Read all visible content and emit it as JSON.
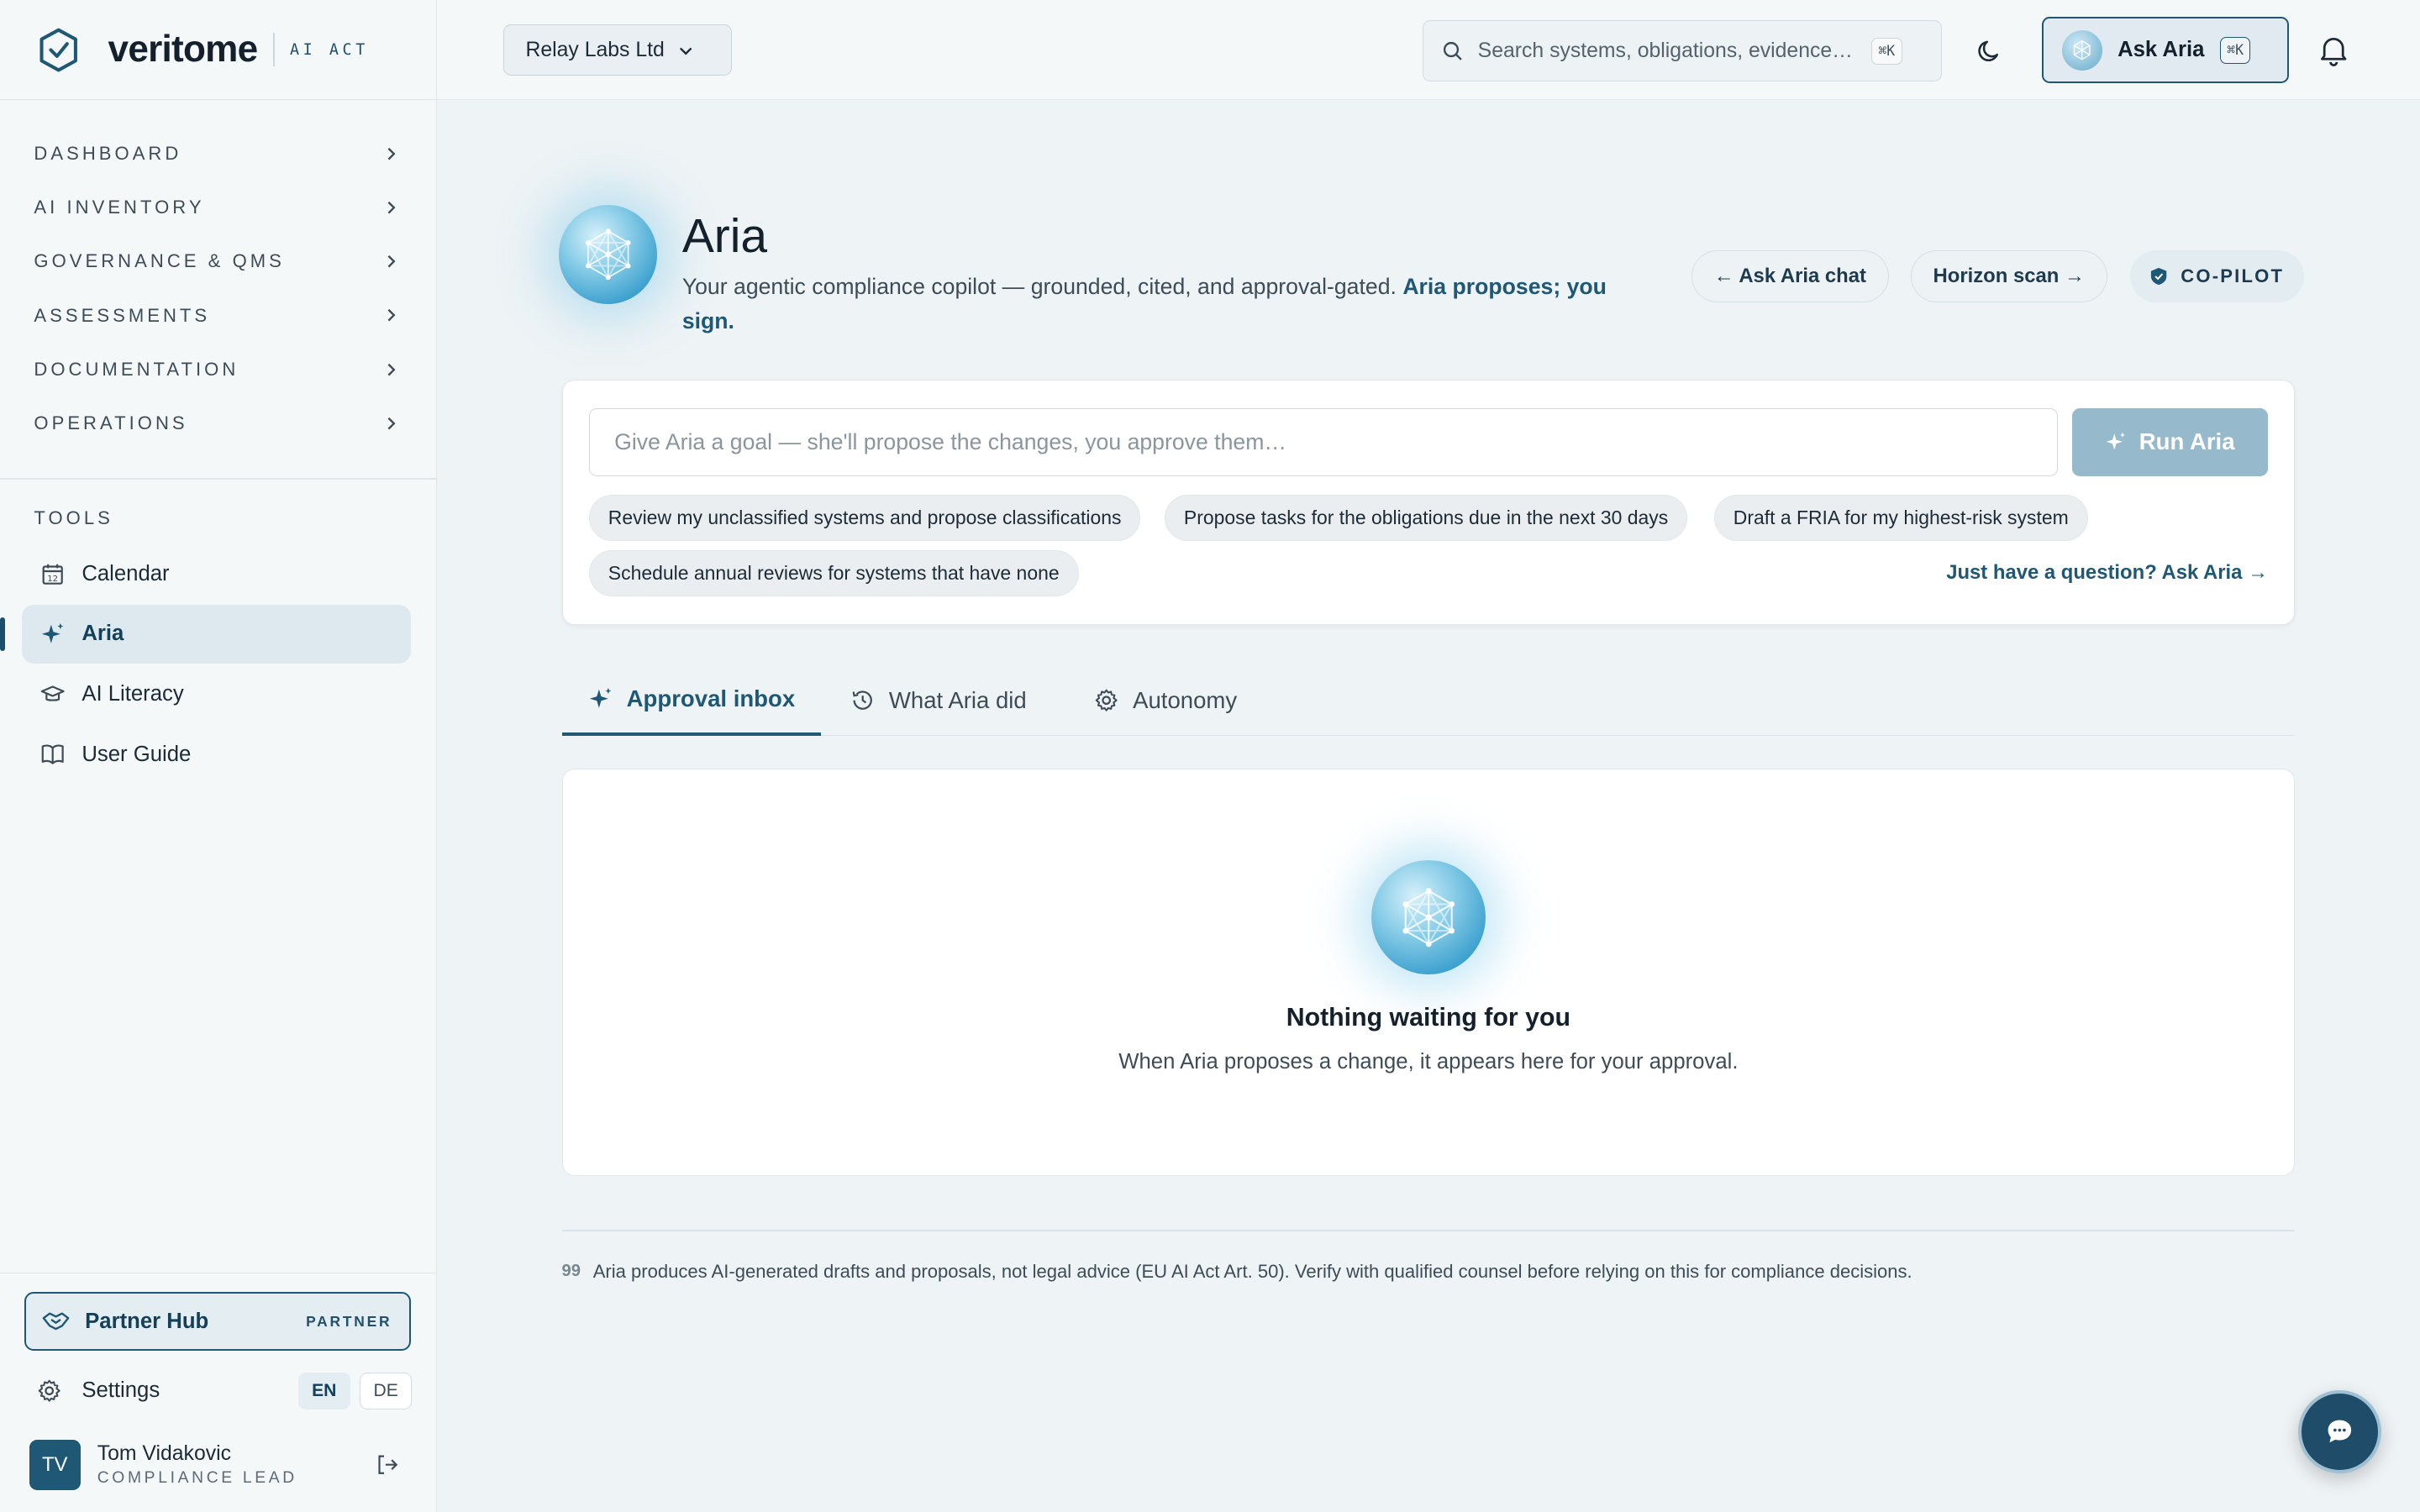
{
  "brand": {
    "name": "veritome",
    "tag": "AI ACT"
  },
  "nav": [
    {
      "label": "DASHBOARD"
    },
    {
      "label": "AI INVENTORY"
    },
    {
      "label": "GOVERNANCE & QMS"
    },
    {
      "label": "ASSESSMENTS"
    },
    {
      "label": "DOCUMENTATION"
    },
    {
      "label": "OPERATIONS"
    }
  ],
  "tools": {
    "label": "TOOLS",
    "items": [
      {
        "label": "Calendar",
        "icon": "calendar-icon"
      },
      {
        "label": "Aria",
        "icon": "sparkle-icon",
        "active": true
      },
      {
        "label": "AI Literacy",
        "icon": "graduation-cap-icon"
      },
      {
        "label": "User Guide",
        "icon": "book-icon"
      }
    ]
  },
  "partner": {
    "label": "Partner Hub",
    "badge": "PARTNER"
  },
  "settings": {
    "label": "Settings",
    "langs": [
      "EN",
      "DE"
    ],
    "active_lang": "EN"
  },
  "user": {
    "initials": "TV",
    "name": "Tom Vidakovic",
    "role": "COMPLIANCE LEAD"
  },
  "topbar": {
    "org": "Relay Labs Ltd",
    "search_placeholder": "Search systems, obligations, evidence…",
    "search_kbd": "⌘K",
    "ask_label": "Ask Aria",
    "ask_kbd": "⌘K"
  },
  "hero": {
    "title": "Aria",
    "subtitle": "Your agentic compliance copilot — grounded, cited, and approval-gated.",
    "subtitle_emphasis": "Aria proposes; you sign.",
    "ask_chat": "← Ask Aria chat",
    "horizon": "Horizon scan →",
    "mode_badge": "CO-PILOT"
  },
  "goal": {
    "placeholder": "Give Aria a goal — she'll propose the changes, you approve them…",
    "run_label": "Run Aria",
    "suggestions": [
      "Review my unclassified systems and propose classifications",
      "Propose tasks for the obligations due in the next 30 days",
      "Draft a FRIA for my highest-risk system",
      "Schedule annual reviews for systems that have none"
    ],
    "question_link": "Just have a question? Ask Aria →"
  },
  "tabs": [
    {
      "label": "Approval inbox",
      "active": true
    },
    {
      "label": "What Aria did"
    },
    {
      "label": "Autonomy"
    }
  ],
  "inbox": {
    "empty_title": "Nothing waiting for you",
    "empty_sub": "When Aria proposes a change, it appears here for your approval."
  },
  "disclaimer": {
    "mark": "99",
    "text": "Aria produces AI-generated drafts and proposals, not legal advice (EU AI Act Art. 50). Verify with qualified counsel before relying on this for compliance decisions."
  },
  "colors": {
    "accent": "#1f5875",
    "background": "#eef3f5",
    "sidebar": "#f5f8f9"
  }
}
